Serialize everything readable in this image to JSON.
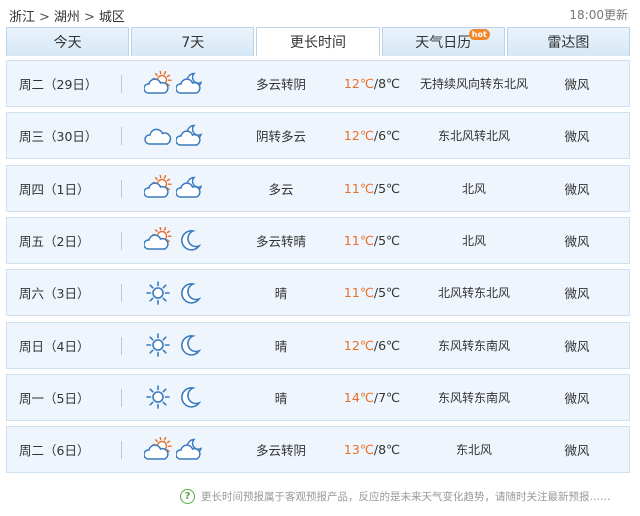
{
  "breadcrumb": {
    "province": "浙江",
    "city": "湖州",
    "district": "城区",
    "separator": ">"
  },
  "update_time": "18:00更新",
  "tabs": [
    {
      "label": "今天",
      "active": false,
      "hot": false
    },
    {
      "label": "7天",
      "active": false,
      "hot": false
    },
    {
      "label": "更长时间",
      "active": true,
      "hot": false
    },
    {
      "label": "天气日历",
      "active": false,
      "hot": true,
      "badge": "hot"
    },
    {
      "label": "雷达图",
      "active": false,
      "hot": false
    }
  ],
  "colors": {
    "high_temp": "#e8702a",
    "icon_blue": "#3a7bbf",
    "icon_sun": "#e8702a",
    "row_bg": "#eef5fc"
  },
  "forecast": [
    {
      "day": "周二（29日）",
      "icon_day": "partly-cloudy-day-icon",
      "icon_night": "partly-cloudy-night-icon",
      "desc": "多云转阴",
      "high": "12℃",
      "low": "/8℃",
      "wind": "无持续风向转东北风",
      "level": "微风"
    },
    {
      "day": "周三（30日）",
      "icon_day": "cloudy-icon",
      "icon_night": "partly-cloudy-night-icon",
      "desc": "阴转多云",
      "high": "12℃",
      "low": "/6℃",
      "wind": "东北风转北风",
      "level": "微风"
    },
    {
      "day": "周四（1日）",
      "icon_day": "partly-cloudy-day-icon",
      "icon_night": "partly-cloudy-night-icon",
      "desc": "多云",
      "high": "11℃",
      "low": "/5℃",
      "wind": "北风",
      "level": "微风"
    },
    {
      "day": "周五（2日）",
      "icon_day": "partly-cloudy-day-icon",
      "icon_night": "moon-icon",
      "desc": "多云转晴",
      "high": "11℃",
      "low": "/5℃",
      "wind": "北风",
      "level": "微风"
    },
    {
      "day": "周六（3日）",
      "icon_day": "sun-icon",
      "icon_night": "moon-icon",
      "desc": "晴",
      "high": "11℃",
      "low": "/5℃",
      "wind": "北风转东北风",
      "level": "微风"
    },
    {
      "day": "周日（4日）",
      "icon_day": "sun-icon",
      "icon_night": "moon-icon",
      "desc": "晴",
      "high": "12℃",
      "low": "/6℃",
      "wind": "东风转东南风",
      "level": "微风"
    },
    {
      "day": "周一（5日）",
      "icon_day": "sun-icon",
      "icon_night": "moon-icon",
      "desc": "晴",
      "high": "14℃",
      "low": "/7℃",
      "wind": "东风转东南风",
      "level": "微风"
    },
    {
      "day": "周二（6日）",
      "icon_day": "partly-cloudy-day-icon",
      "icon_night": "partly-cloudy-night-icon",
      "desc": "多云转阴",
      "high": "13℃",
      "low": "/8℃",
      "wind": "东北风",
      "level": "微风"
    }
  ],
  "footer": {
    "help_glyph": "?",
    "note": "更长时间预报属于客观预报产品，反应的是未来天气变化趋势，请随时关注最新预报……"
  }
}
